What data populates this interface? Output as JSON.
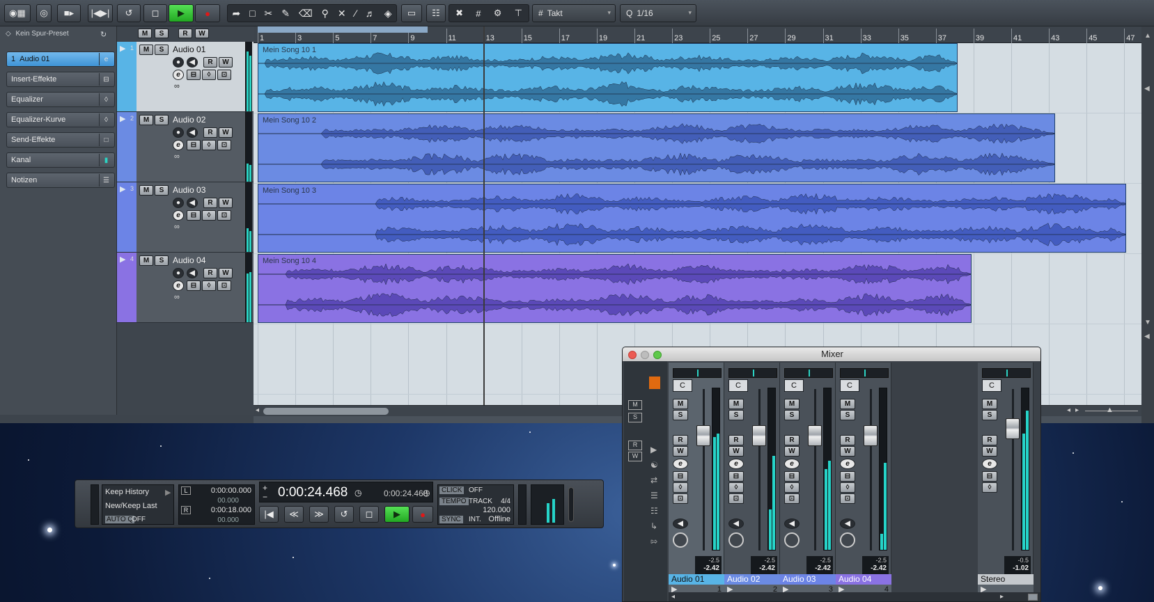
{
  "toolbar": {
    "snap_type": "Takt",
    "quantize_label": "Q",
    "quantize_value": "1/16"
  },
  "inspector": {
    "preset": "Kein Spur-Preset",
    "track_num": "1",
    "track_name": "Audio 01",
    "sections": [
      "Insert-Effekte",
      "Equalizer",
      "Equalizer-Kurve",
      "Send-Effekte",
      "Kanal",
      "Notizen"
    ]
  },
  "tracks": [
    {
      "num": "1",
      "name": "Audio 01",
      "event": "Mein Song 10 1",
      "color": "#58b4e6"
    },
    {
      "num": "2",
      "name": "Audio 02",
      "event": "Mein Song 10 2",
      "color": "#6b8be3"
    },
    {
      "num": "3",
      "name": "Audio 03",
      "event": "Mein Song 10 3",
      "color": "#6c84e6"
    },
    {
      "num": "4",
      "name": "Audio 04",
      "event": "Mein Song 10 4",
      "color": "#8a72e3"
    }
  ],
  "track_buttons": {
    "mute": "M",
    "solo": "S",
    "read": "R",
    "write": "W",
    "edit": "e"
  },
  "ruler_ticks": [
    "1",
    "3",
    "5",
    "7",
    "9",
    "11",
    "13",
    "15",
    "17",
    "19",
    "21",
    "23",
    "25",
    "27",
    "29",
    "31",
    "33",
    "35",
    "37",
    "39",
    "41",
    "43",
    "45",
    "47"
  ],
  "transport": {
    "history1": "Keep History",
    "history2": "New/Keep Last",
    "autoq_label": "AUTO Q",
    "autoq_value": "OFF",
    "left_locator": "0:00:00.000",
    "left_sub": "00.000",
    "right_locator": "0:00:18.000",
    "right_sub": "00.000",
    "left_label": "L",
    "right_label": "R",
    "main_time": "0:00:24.468",
    "secondary_time": "0:00:24.468",
    "click_label": "CLICK",
    "click_value": "OFF",
    "tempo_label": "TEMPO",
    "tempo_mode": "TRACK",
    "signature": "4/4",
    "tempo": "120.000",
    "sync_label": "SYNC",
    "sync_mode": "INT.",
    "sync_status": "Offline"
  },
  "mixer": {
    "title": "Mixer",
    "channels": [
      {
        "name": "Audio 01",
        "num": "1",
        "pan": "C",
        "peak_top": "-2.5",
        "peak": "-2.42",
        "fader": 0.76,
        "meter_l": 0.7,
        "meter_r": 0.72,
        "name_bg": "#58b4e6"
      },
      {
        "name": "Audio 02",
        "num": "2",
        "pan": "C",
        "peak_top": "-2.5",
        "peak": "-2.42",
        "fader": 0.76,
        "meter_l": 0.25,
        "meter_r": 0.58,
        "name_bg": "#6b8be3"
      },
      {
        "name": "Audio 03",
        "num": "3",
        "pan": "C",
        "peak_top": "-2.5",
        "peak": "-2.42",
        "fader": 0.76,
        "meter_l": 0.5,
        "meter_r": 0.55,
        "name_bg": "#6c84e6"
      },
      {
        "name": "Audio 04",
        "num": "4",
        "pan": "C",
        "peak_top": "-2.5",
        "peak": "-2.42",
        "fader": 0.76,
        "meter_l": 0.1,
        "meter_r": 0.54,
        "name_bg": "#8a72e3"
      },
      {
        "name": "Stereo",
        "num": "",
        "pan": "C",
        "peak_top": "-0.5",
        "peak": "-1.02",
        "fader": 0.8,
        "meter_l": 0.72,
        "meter_r": 0.86,
        "name_bg": "#c4c8cc"
      }
    ],
    "selected": 0
  }
}
